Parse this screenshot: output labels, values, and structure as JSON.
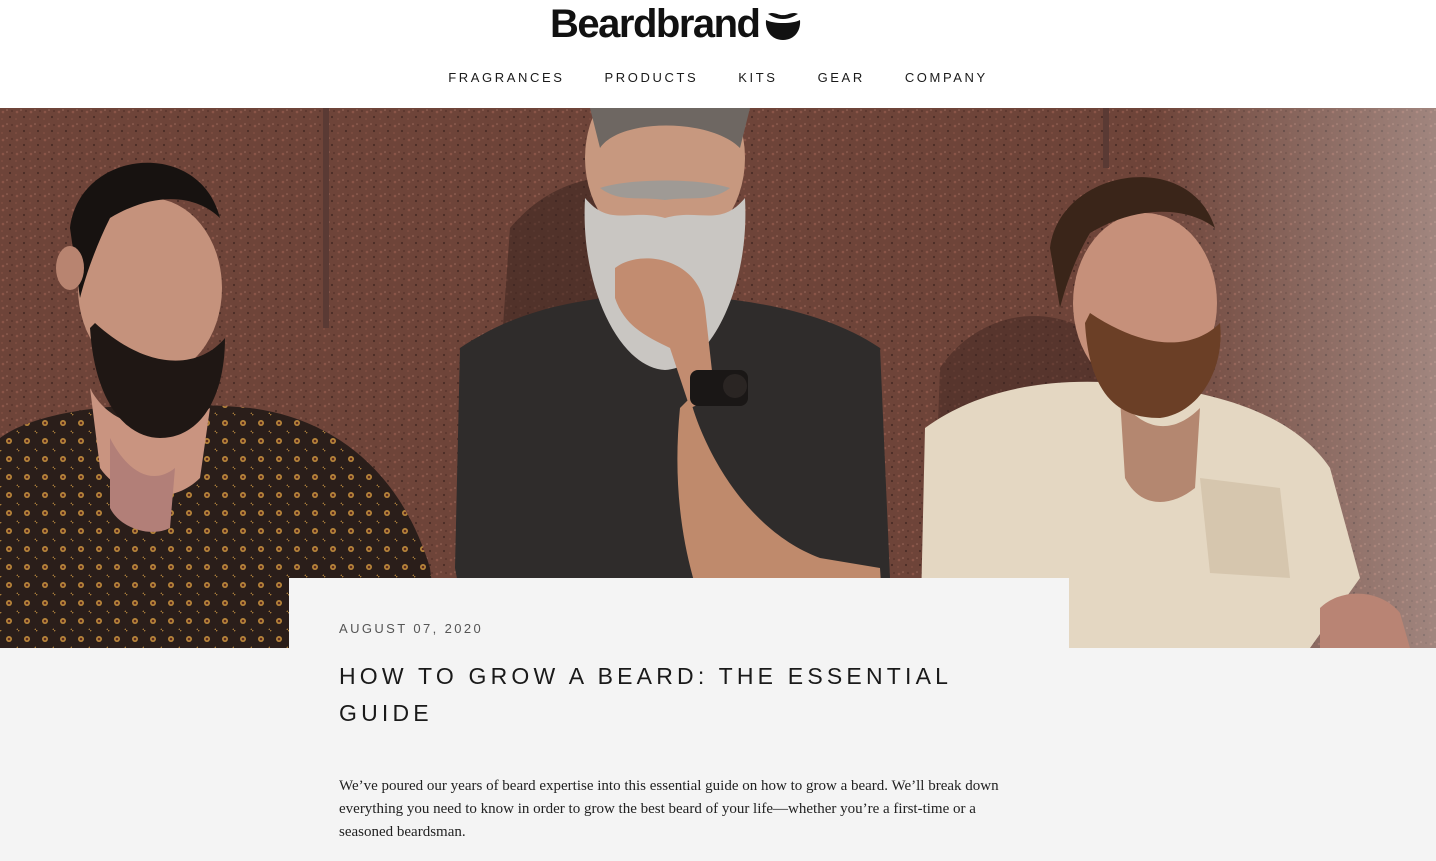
{
  "brand": {
    "name": "Beardbrand",
    "logo_icon": "beard-icon"
  },
  "nav": {
    "items": [
      {
        "label": "FRAGRANCES"
      },
      {
        "label": "PRODUCTS"
      },
      {
        "label": "KITS"
      },
      {
        "label": "GEAR"
      },
      {
        "label": "COMPANY"
      }
    ]
  },
  "hero": {
    "image": "three bearded men leaning against a red granite wall"
  },
  "article": {
    "date": "AUGUST 07, 2020",
    "title": "HOW TO GROW A BEARD: THE ESSENTIAL GUIDE",
    "intro": "We’ve poured our years of beard expertise into this essential guide on how to grow a beard. We’ll break down everything you need to know in order to grow the best beard of your life—whether you’re a first-time or a seasoned beardsman."
  },
  "colors": {
    "background": "#f4f4f4",
    "header": "#ffffff",
    "text": "#1a1a1a",
    "wall": "#6a4238"
  }
}
